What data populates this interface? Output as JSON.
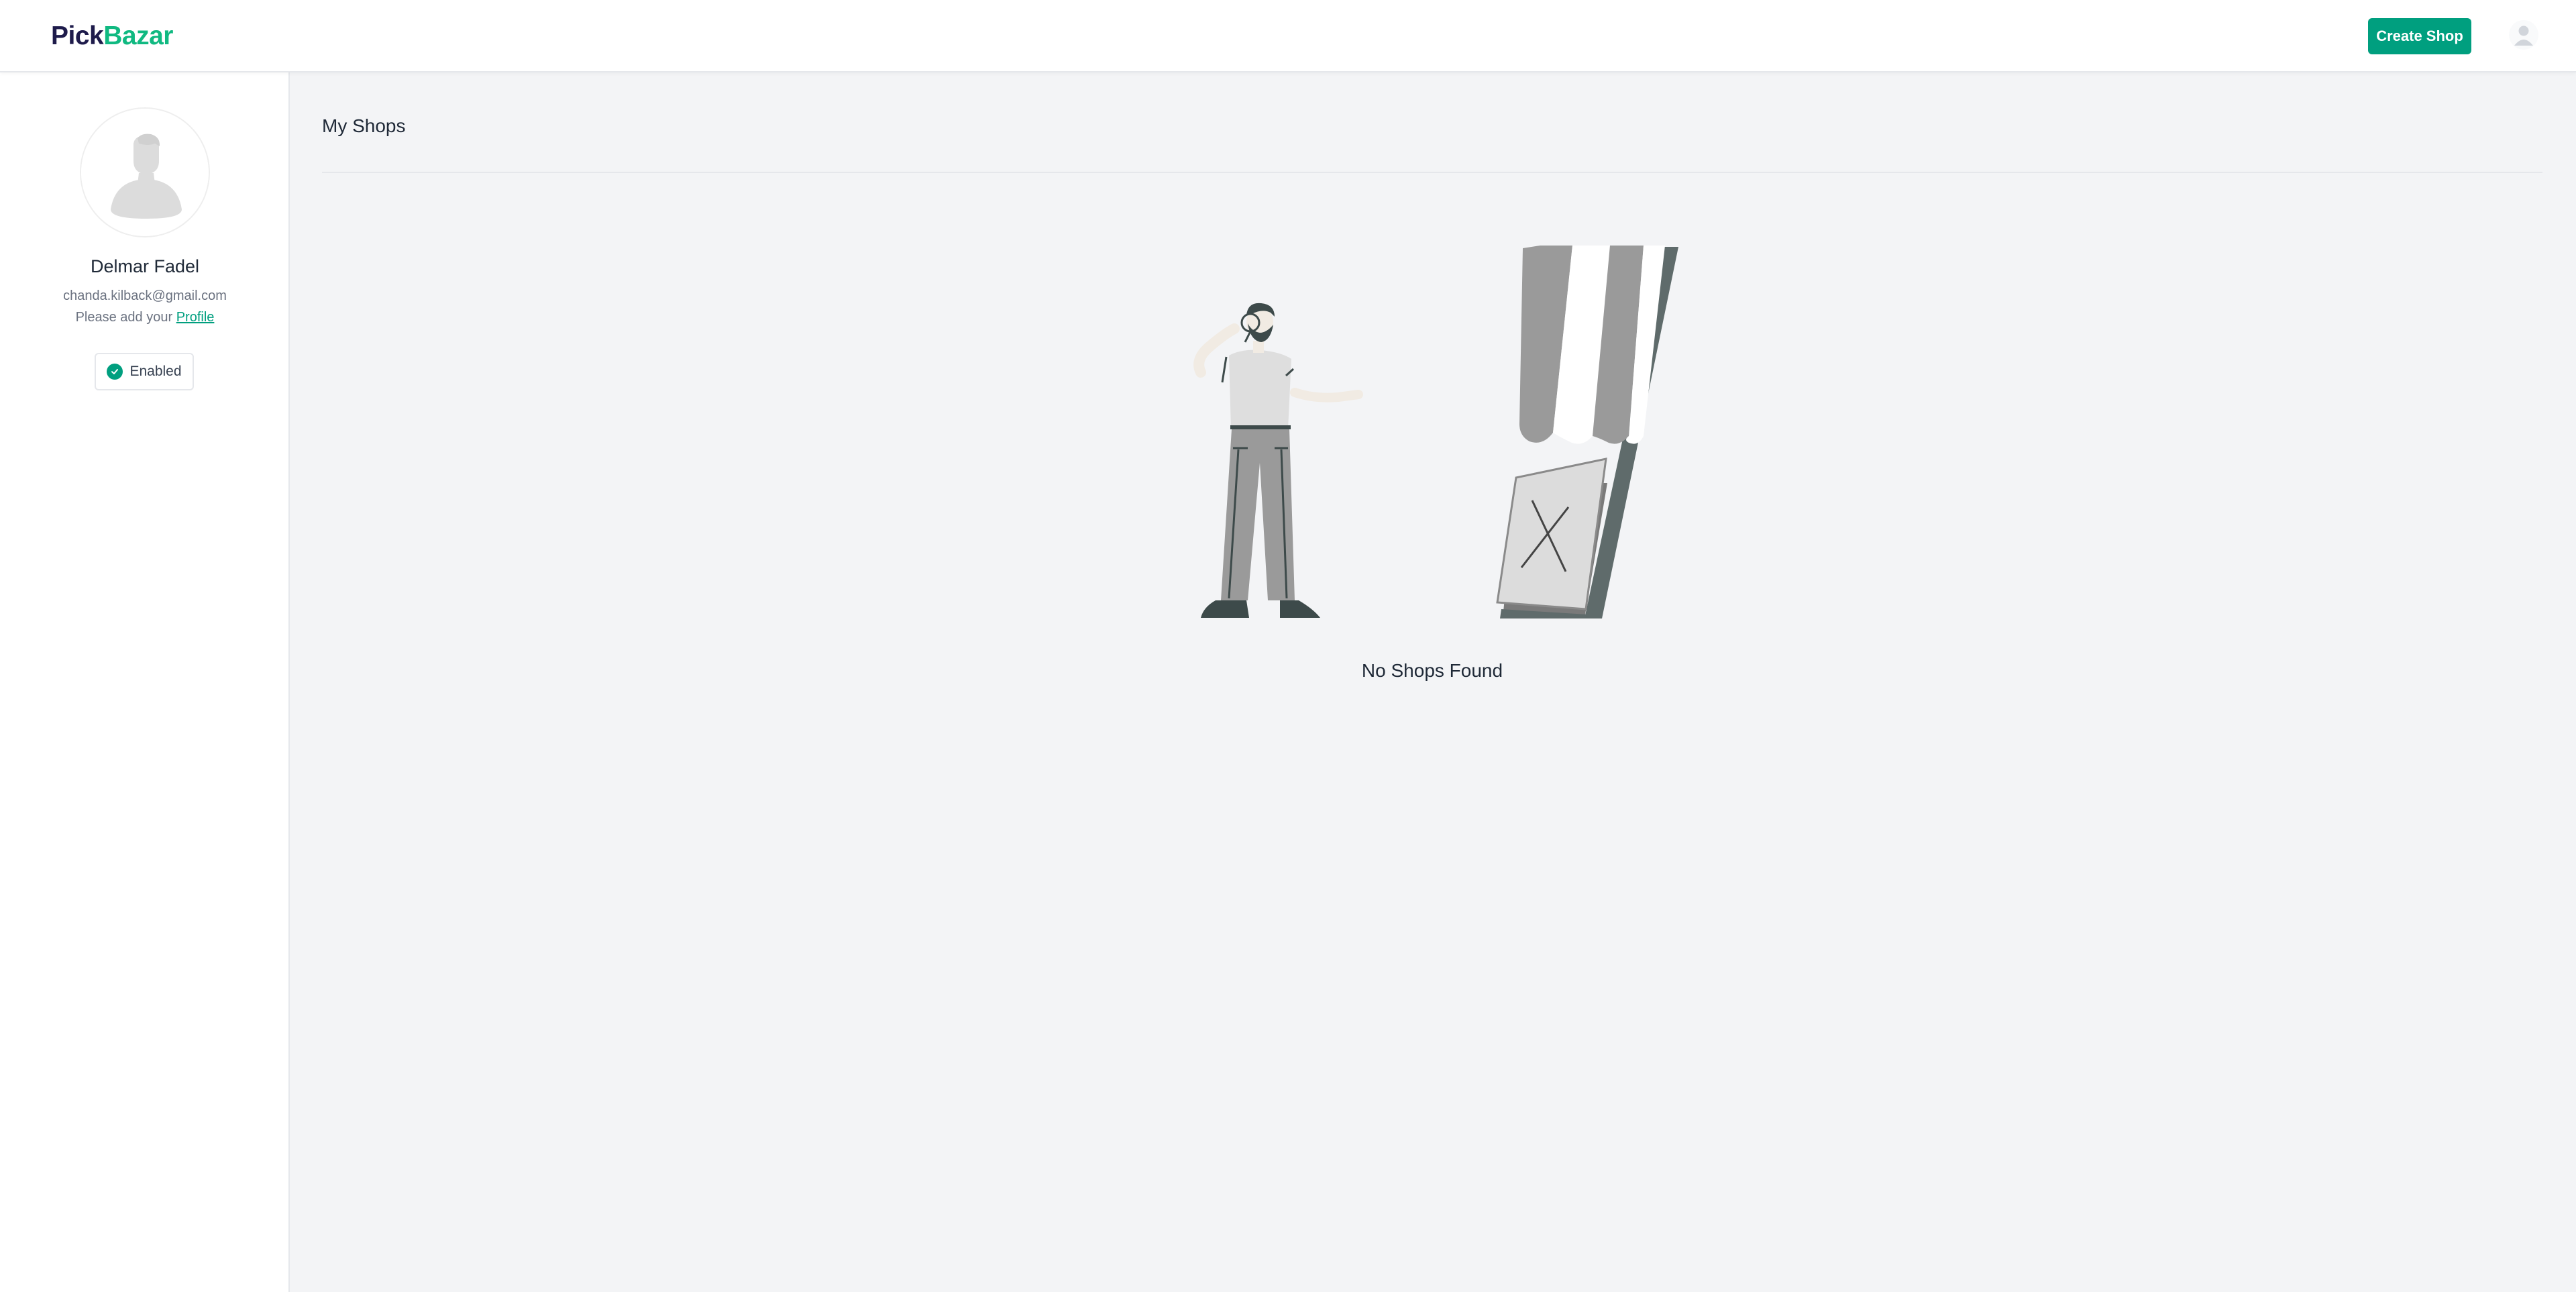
{
  "header": {
    "logo_part1": "Pick",
    "logo_part2": "Bazar",
    "create_shop_label": "Create Shop"
  },
  "sidebar": {
    "user_name": "Delmar Fadel",
    "user_email": "chanda.kilback@gmail.com",
    "profile_hint": "Please add your",
    "profile_link": "Profile",
    "status": "Enabled"
  },
  "main": {
    "title": "My Shops",
    "empty_message": "No Shops Found"
  },
  "colors": {
    "brand_green": "#009f7f",
    "logo_dark": "#1e1b4b",
    "logo_green": "#10b981",
    "background": "#f3f4f6"
  },
  "icons": {
    "header_avatar": "user-avatar-icon",
    "profile_avatar": "user-silhouette-icon",
    "status": "check-circle-icon",
    "empty_state": "closed-shop-illustration"
  }
}
